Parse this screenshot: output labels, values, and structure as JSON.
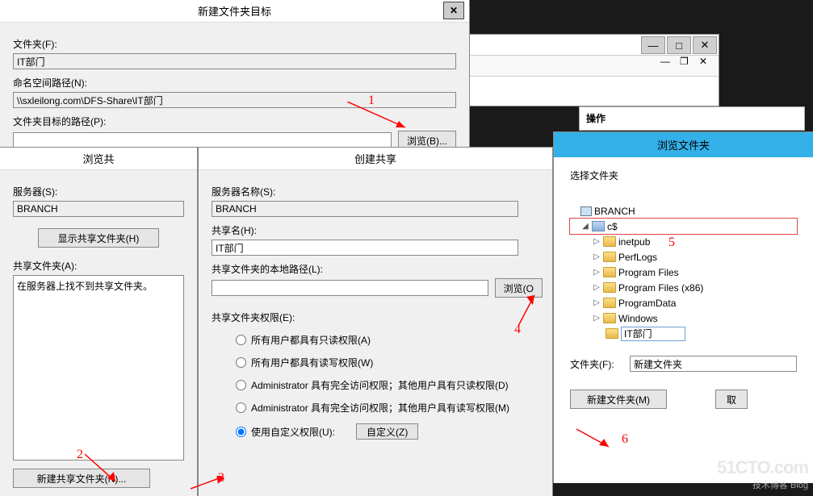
{
  "dlg_target": {
    "title": "新建文件夹目标",
    "folder_label": "文件夹(F):",
    "folder_value": "IT部门",
    "ns_label": "命名空间路径(N):",
    "ns_value": "\\\\sxleilong.com\\DFS-Share\\IT部门",
    "path_label": "文件夹目标的路径(P):",
    "browse_btn": "浏览(B)..."
  },
  "dlg_browse_share": {
    "title": "浏览共",
    "server_label": "服务器(S):",
    "server_value": "BRANCH",
    "show_btn": "显示共享文件夹(H)",
    "shared_label": "共享文件夹(A):",
    "msg": "在服务器上找不到共享文件夹。",
    "new_share_btn": "新建共享文件夹(N)..."
  },
  "dlg_create_share": {
    "title": "创建共享",
    "server_label": "服务器名称(S):",
    "server_value": "BRANCH",
    "share_label": "共享名(H):",
    "share_value": "IT部门",
    "local_label": "共享文件夹的本地路径(L):",
    "browse_btn": "浏览(O",
    "perm_label": "共享文件夹权限(E):",
    "r1": "所有用户都具有只读权限(A)",
    "r2": "所有用户都具有读写权限(W)",
    "r3": "Administrator 具有完全访问权限；其他用户具有只读权限(D)",
    "r4": "Administrator 具有完全访问权限；其他用户具有读写权限(M)",
    "r5": "使用自定义权限(U):",
    "custom_btn": "自定义(Z)"
  },
  "panel_ops": "操作",
  "dlg_browse_folder": {
    "title_bar": "浏览文件夹",
    "select_label": "选择文件夹",
    "tree": {
      "root": "BRANCH",
      "drive": "c$",
      "items": [
        "inetpub",
        "PerfLogs",
        "Program Files",
        "Program Files (x86)",
        "ProgramData",
        "Windows"
      ],
      "editing": "IT部门"
    },
    "folder_label": "文件夹(F):",
    "folder_value": "新建文件夹",
    "new_btn": "新建文件夹(M)",
    "cancel": "取消"
  },
  "annotations": {
    "a1": "1",
    "a2": "2",
    "a3": "3",
    "a4": "4",
    "a5": "5",
    "a6": "6"
  },
  "watermark": {
    "l1": "51CTO.com",
    "l2": "技术博客  Blog"
  }
}
